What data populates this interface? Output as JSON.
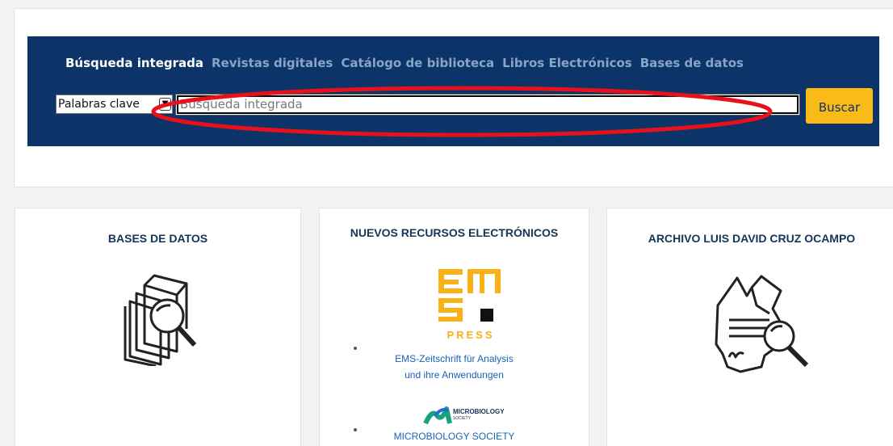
{
  "search": {
    "tabs": [
      {
        "label": "Búsqueda integrada",
        "active": true
      },
      {
        "label": "Revistas digitales",
        "active": false
      },
      {
        "label": "Catálogo de biblioteca",
        "active": false
      },
      {
        "label": "Libros Electrónicos",
        "active": false
      },
      {
        "label": "Bases de datos",
        "active": false
      }
    ],
    "select_value": "Palabras clave",
    "input_placeholder": "Búsqueda integrada",
    "button_label": "Buscar"
  },
  "cards": {
    "databases": {
      "title": "BASES DE DATOS",
      "icon": "books-magnifier-icon"
    },
    "new_resources": {
      "title": "NUEVOS RECURSOS ELECTRÓNICOS",
      "ems_logo_text": "PRESS",
      "items": [
        {
          "line1": "EMS-Zeitschrift für Analysis",
          "line2": "und ihre Anwendungen"
        },
        {
          "line1": "MICROBIOLOGY SOCIETY",
          "line2": ""
        }
      ],
      "ms_logo_line1": "MICROBIOLOGY",
      "ms_logo_line2": "SOCIETY"
    },
    "archive": {
      "title": "ARCHIVO LUIS DAVID CRUZ OCAMPO",
      "icon": "document-magnifier-icon"
    }
  },
  "colors": {
    "band": "#0c3468",
    "button": "#fbbb17",
    "highlight": "#e8101a",
    "link": "#1a62b8"
  }
}
